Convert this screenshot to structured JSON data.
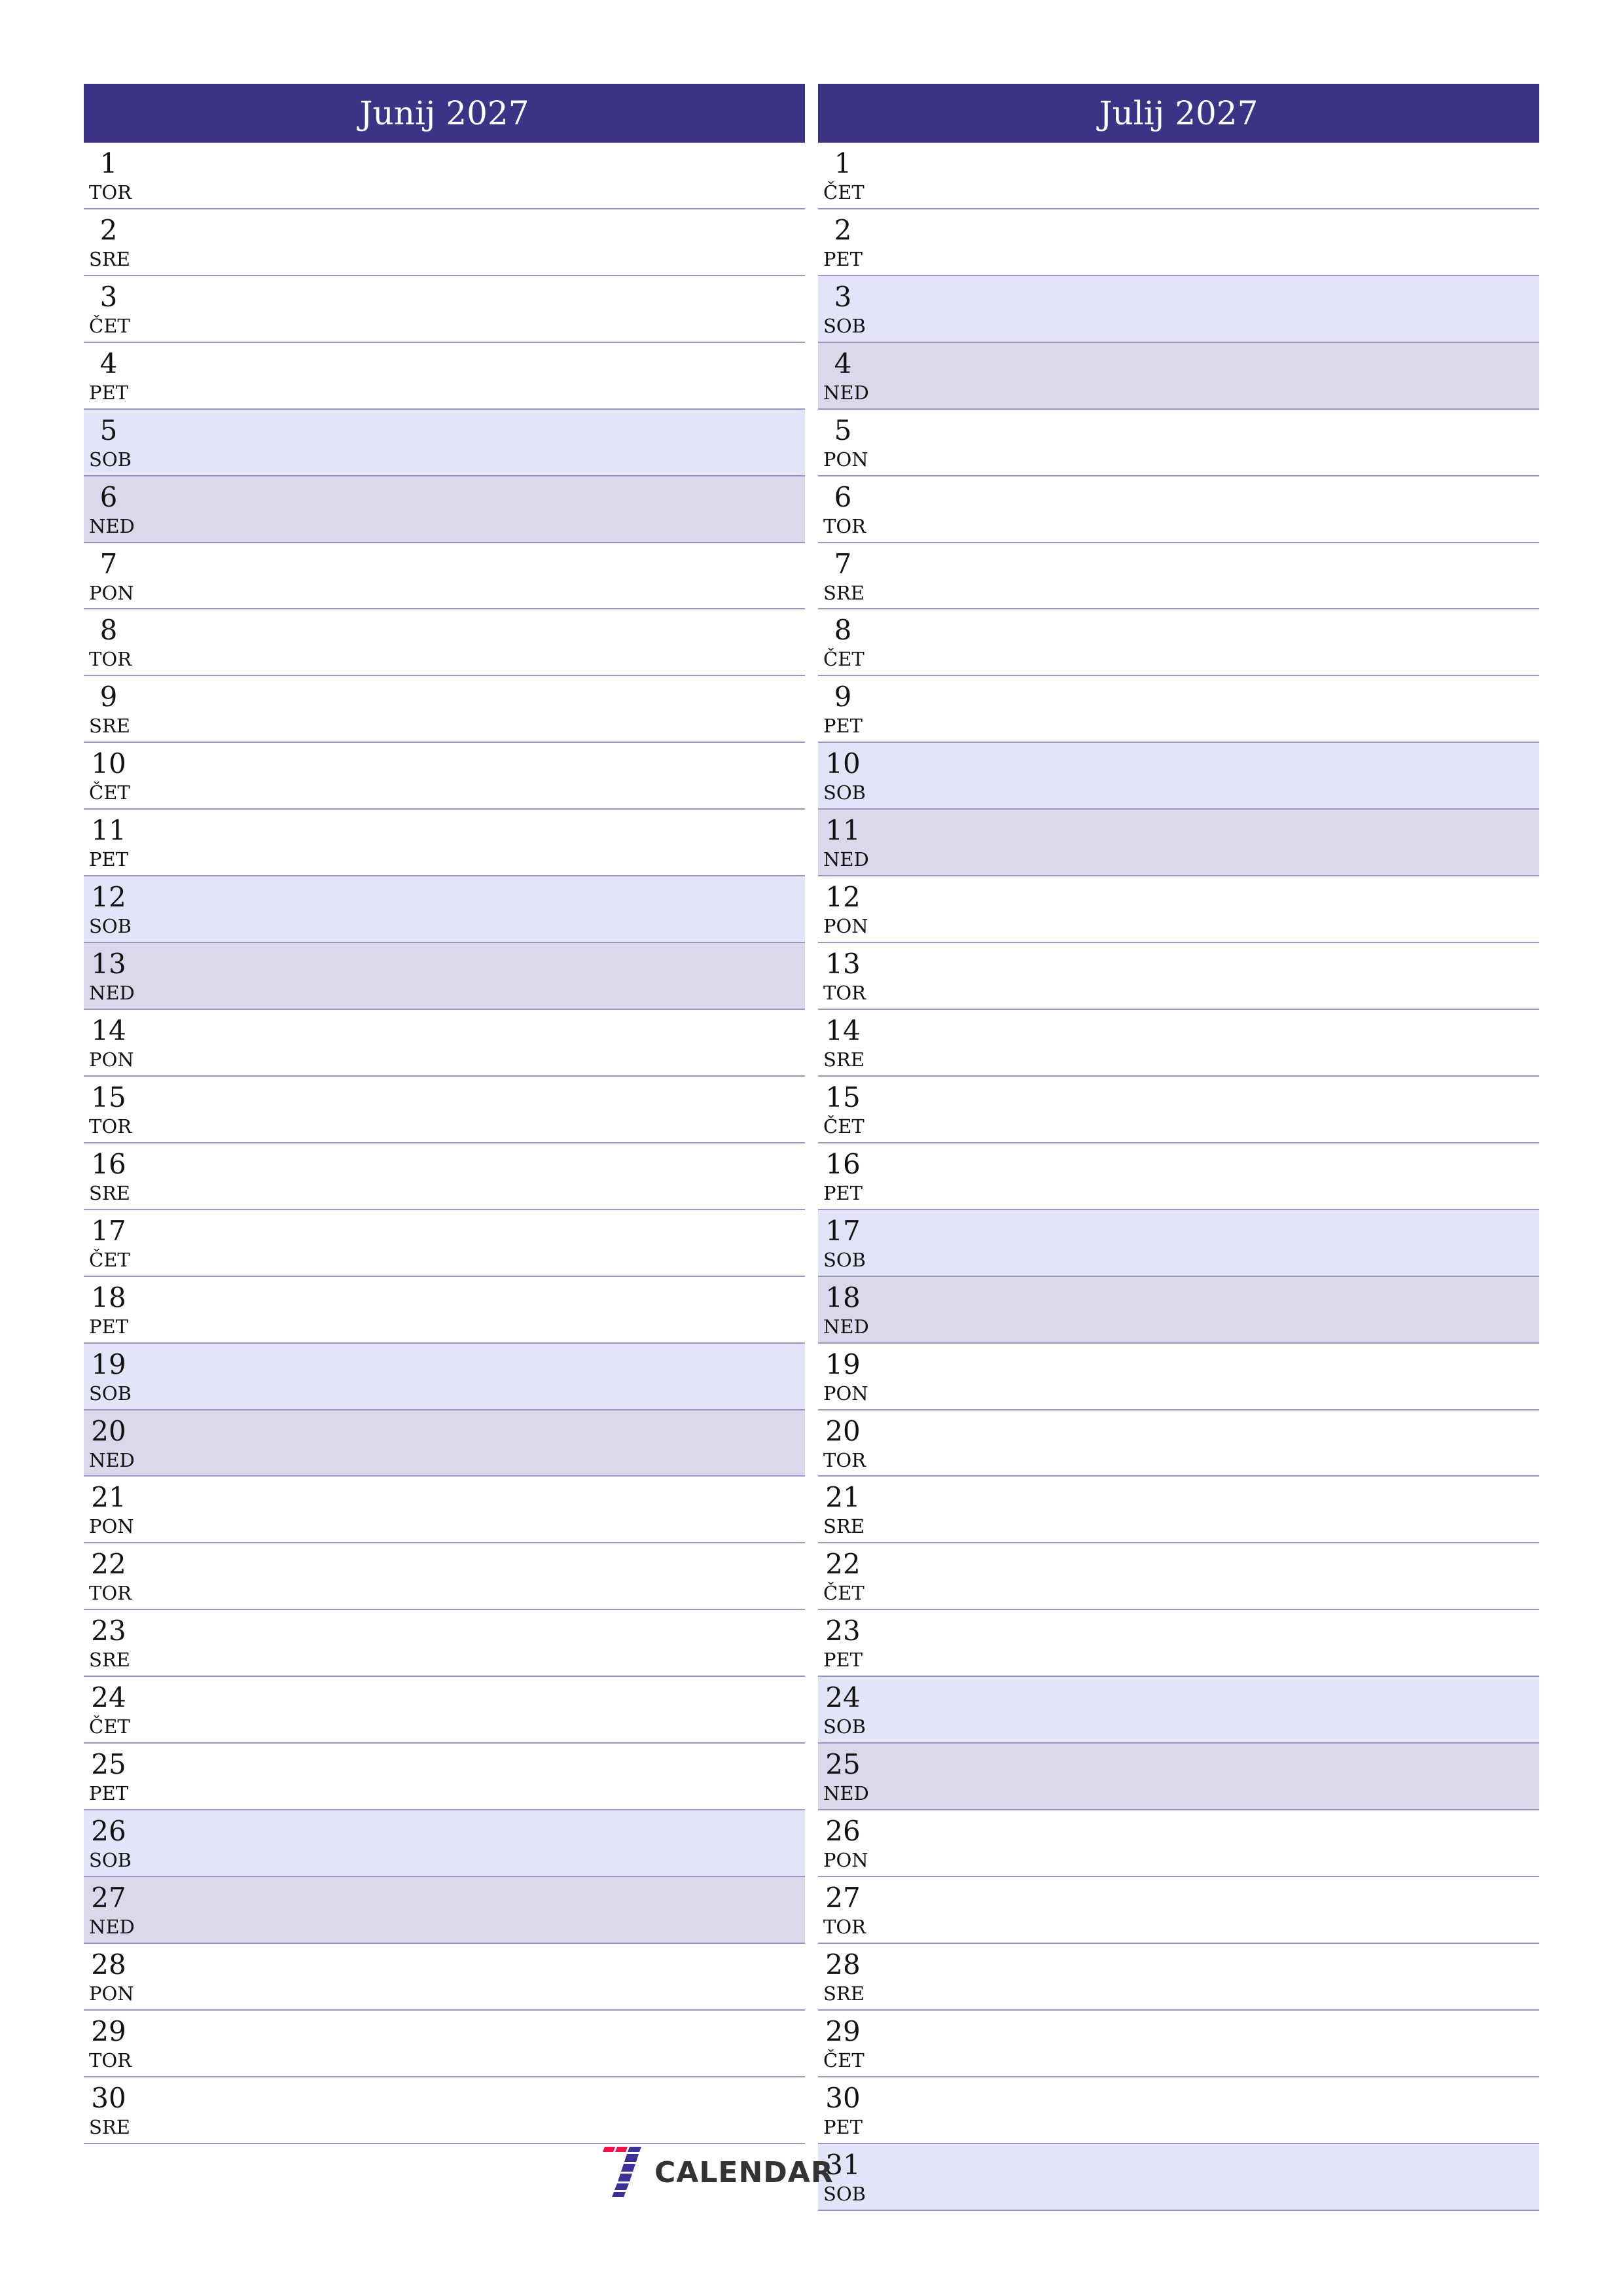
{
  "months": [
    {
      "title": "Junij 2027",
      "days": [
        {
          "num": "1",
          "name": "TOR",
          "type": "weekday"
        },
        {
          "num": "2",
          "name": "SRE",
          "type": "weekday"
        },
        {
          "num": "3",
          "name": "ČET",
          "type": "weekday"
        },
        {
          "num": "4",
          "name": "PET",
          "type": "weekday"
        },
        {
          "num": "5",
          "name": "SOB",
          "type": "sat"
        },
        {
          "num": "6",
          "name": "NED",
          "type": "sun"
        },
        {
          "num": "7",
          "name": "PON",
          "type": "weekday"
        },
        {
          "num": "8",
          "name": "TOR",
          "type": "weekday"
        },
        {
          "num": "9",
          "name": "SRE",
          "type": "weekday"
        },
        {
          "num": "10",
          "name": "ČET",
          "type": "weekday"
        },
        {
          "num": "11",
          "name": "PET",
          "type": "weekday"
        },
        {
          "num": "12",
          "name": "SOB",
          "type": "sat"
        },
        {
          "num": "13",
          "name": "NED",
          "type": "sun"
        },
        {
          "num": "14",
          "name": "PON",
          "type": "weekday"
        },
        {
          "num": "15",
          "name": "TOR",
          "type": "weekday"
        },
        {
          "num": "16",
          "name": "SRE",
          "type": "weekday"
        },
        {
          "num": "17",
          "name": "ČET",
          "type": "weekday"
        },
        {
          "num": "18",
          "name": "PET",
          "type": "weekday"
        },
        {
          "num": "19",
          "name": "SOB",
          "type": "sat"
        },
        {
          "num": "20",
          "name": "NED",
          "type": "sun"
        },
        {
          "num": "21",
          "name": "PON",
          "type": "weekday"
        },
        {
          "num": "22",
          "name": "TOR",
          "type": "weekday"
        },
        {
          "num": "23",
          "name": "SRE",
          "type": "weekday"
        },
        {
          "num": "24",
          "name": "ČET",
          "type": "weekday"
        },
        {
          "num": "25",
          "name": "PET",
          "type": "weekday"
        },
        {
          "num": "26",
          "name": "SOB",
          "type": "sat"
        },
        {
          "num": "27",
          "name": "NED",
          "type": "sun"
        },
        {
          "num": "28",
          "name": "PON",
          "type": "weekday"
        },
        {
          "num": "29",
          "name": "TOR",
          "type": "weekday"
        },
        {
          "num": "30",
          "name": "SRE",
          "type": "weekday"
        }
      ]
    },
    {
      "title": "Julij 2027",
      "days": [
        {
          "num": "1",
          "name": "ČET",
          "type": "weekday"
        },
        {
          "num": "2",
          "name": "PET",
          "type": "weekday"
        },
        {
          "num": "3",
          "name": "SOB",
          "type": "sat"
        },
        {
          "num": "4",
          "name": "NED",
          "type": "sun"
        },
        {
          "num": "5",
          "name": "PON",
          "type": "weekday"
        },
        {
          "num": "6",
          "name": "TOR",
          "type": "weekday"
        },
        {
          "num": "7",
          "name": "SRE",
          "type": "weekday"
        },
        {
          "num": "8",
          "name": "ČET",
          "type": "weekday"
        },
        {
          "num": "9",
          "name": "PET",
          "type": "weekday"
        },
        {
          "num": "10",
          "name": "SOB",
          "type": "sat"
        },
        {
          "num": "11",
          "name": "NED",
          "type": "sun"
        },
        {
          "num": "12",
          "name": "PON",
          "type": "weekday"
        },
        {
          "num": "13",
          "name": "TOR",
          "type": "weekday"
        },
        {
          "num": "14",
          "name": "SRE",
          "type": "weekday"
        },
        {
          "num": "15",
          "name": "ČET",
          "type": "weekday"
        },
        {
          "num": "16",
          "name": "PET",
          "type": "weekday"
        },
        {
          "num": "17",
          "name": "SOB",
          "type": "sat"
        },
        {
          "num": "18",
          "name": "NED",
          "type": "sun"
        },
        {
          "num": "19",
          "name": "PON",
          "type": "weekday"
        },
        {
          "num": "20",
          "name": "TOR",
          "type": "weekday"
        },
        {
          "num": "21",
          "name": "SRE",
          "type": "weekday"
        },
        {
          "num": "22",
          "name": "ČET",
          "type": "weekday"
        },
        {
          "num": "23",
          "name": "PET",
          "type": "weekday"
        },
        {
          "num": "24",
          "name": "SOB",
          "type": "sat"
        },
        {
          "num": "25",
          "name": "NED",
          "type": "sun"
        },
        {
          "num": "26",
          "name": "PON",
          "type": "weekday"
        },
        {
          "num": "27",
          "name": "TOR",
          "type": "weekday"
        },
        {
          "num": "28",
          "name": "SRE",
          "type": "weekday"
        },
        {
          "num": "29",
          "name": "ČET",
          "type": "weekday"
        },
        {
          "num": "30",
          "name": "PET",
          "type": "weekday"
        },
        {
          "num": "31",
          "name": "SOB",
          "type": "sat"
        }
      ]
    }
  ],
  "logo": {
    "icon": "seven-calendar-logo-icon",
    "text": "CALENDAR"
  },
  "colors": {
    "header_bg": "#3b3386",
    "header_text": "#ffffff",
    "saturday_bg": "#e4e4f8",
    "sunday_bg": "#dcd8ec",
    "row_border": "#9a95c4",
    "logo_red": "#f0144a",
    "logo_blue": "#3b3196",
    "logo_text": "#333333"
  }
}
